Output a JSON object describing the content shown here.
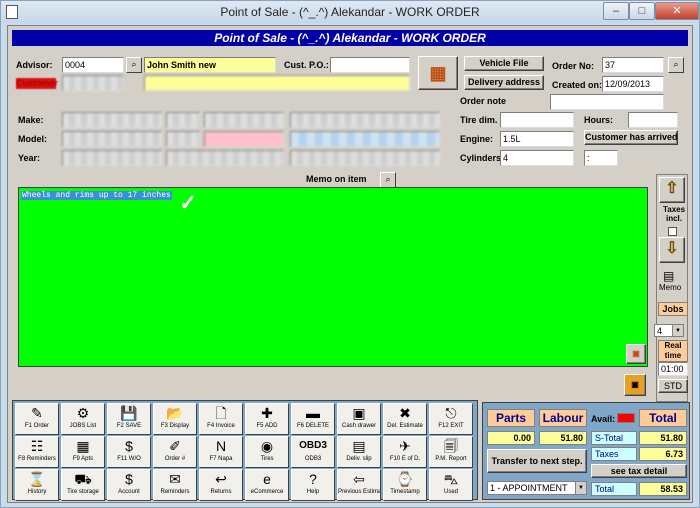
{
  "window": {
    "title": "Point of Sale - (^_.^) Alekandar - WORK ORDER",
    "min": "–",
    "max": "□",
    "close": "✕"
  },
  "header": {
    "title": "Point of Sale - (^_.^) Alekandar - WORK ORDER"
  },
  "form": {
    "advisor_label": "Advisor:",
    "advisor_code": "0004",
    "advisor_name": "John Smith new",
    "cust_po_label": "Cust. P.O.:",
    "cust_po": "",
    "customer_label": "Customer",
    "make_label": "Make:",
    "model_label": "Model:",
    "year_label": "Year:",
    "tire_dim_label": "Tire dim.",
    "engine_label": "Engine:",
    "engine": "1.5L",
    "cylinders_label": "Cylinders:",
    "cylinders": "4",
    "order_no_label": "Order No:",
    "order_no": "37",
    "created_label": "Created on:",
    "created_on": "12/09/2013",
    "hours_label": "Hours:",
    "hours": "",
    "order_note_label": "Order note",
    "vehicle_file_btn": "Vehicle File",
    "delivery_btn": "Delivery address",
    "customer_arrived_btn": "Customer has arrived",
    "arrived_value": ":"
  },
  "memo": {
    "label": "Memo on item",
    "text": "Wheels and rims up to 17 inches"
  },
  "side": {
    "taxes_incl": "Taxes incl.",
    "memo": "Memo",
    "jobs": "Jobs",
    "jobs_value": "4",
    "real_time": "Real time",
    "time_value": "01:00",
    "std": "STD"
  },
  "fkeys": [
    {
      "label": "F1 Order",
      "icon": "✎"
    },
    {
      "label": "JOBS List",
      "icon": "⚙"
    },
    {
      "label": "F2 SAVE",
      "icon": "💾"
    },
    {
      "label": "F3 Display",
      "icon": "📂"
    },
    {
      "label": "F4 Invoice",
      "icon": "🗋"
    },
    {
      "label": "F5 ADD",
      "icon": "✚"
    },
    {
      "label": "F6 DELETE",
      "icon": "▬"
    },
    {
      "label": "Cash drawer",
      "icon": "▣"
    },
    {
      "label": "Del. Estimate",
      "icon": "✖"
    },
    {
      "label": "F12 EXIT",
      "icon": "⎋"
    },
    {
      "label": "F8 Reminders",
      "icon": "☷"
    },
    {
      "label": "F9 Apts",
      "icon": "▦"
    },
    {
      "label": "F11 W/O",
      "icon": "$"
    },
    {
      "label": "Order #",
      "icon": "✐"
    },
    {
      "label": "F7 Napa",
      "icon": "N"
    },
    {
      "label": "Tires",
      "icon": "◉"
    },
    {
      "label": "ODB3",
      "icon": "OBD3"
    },
    {
      "label": "Deliv. slip",
      "icon": "▤"
    },
    {
      "label": "F10 E of D.",
      "icon": "✈"
    },
    {
      "label": "P.M. Report",
      "icon": "🗐"
    },
    {
      "label": "History",
      "icon": "⌛"
    },
    {
      "label": "Tire storage",
      "icon": "⛟"
    },
    {
      "label": "Account",
      "icon": "$"
    },
    {
      "label": "Reminders",
      "icon": "✉"
    },
    {
      "label": "Returns",
      "icon": "↩"
    },
    {
      "label": "eCommerce",
      "icon": "e"
    },
    {
      "label": "Help",
      "icon": "?"
    },
    {
      "label": "Previous Estimate",
      "icon": "⇦"
    },
    {
      "label": "Timestamp",
      "icon": "⌚"
    },
    {
      "label": "Used",
      "icon": "⛍"
    }
  ],
  "totals": {
    "parts_label": "Parts",
    "labour_label": "Labour",
    "avail_label": "Avail:",
    "total_label": "Total",
    "parts": "0.00",
    "labour": "51.80",
    "stotal_label": "S-Total",
    "stotal": "51.80",
    "taxes_label": "Taxes",
    "taxes": "6.73",
    "transfer_btn": "Transfer to next step.",
    "tax_detail_btn": "see tax detail",
    "step": "1 - APPOINTMENT",
    "grand_label": "Total",
    "grand": "58.53"
  }
}
